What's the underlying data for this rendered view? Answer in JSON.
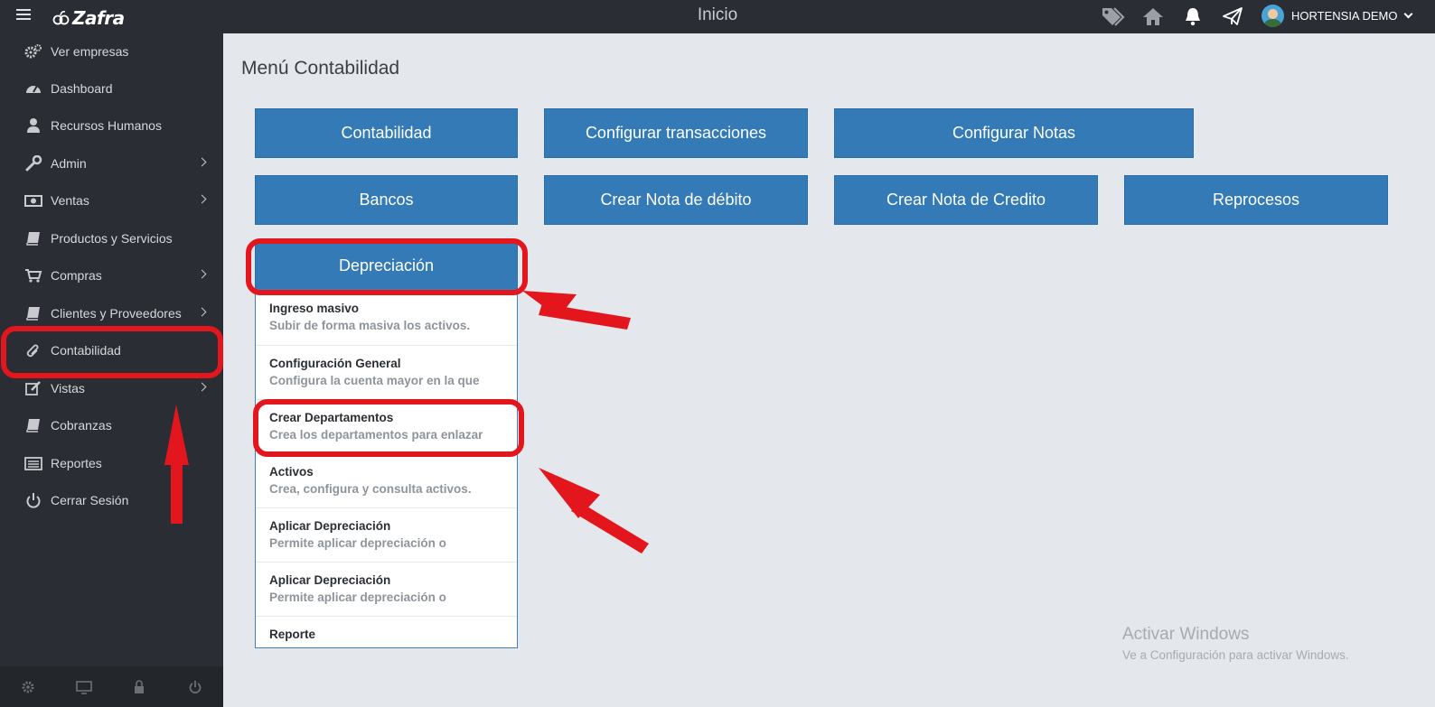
{
  "topbar": {
    "brand": "Zafra",
    "title": "Inicio",
    "icons": [
      "tags-icon",
      "home-icon",
      "bell-icon",
      "paper-plane-icon"
    ],
    "user_name": "HORTENSIA DEMO"
  },
  "sidebar": {
    "items": [
      {
        "label": "Ver empresas",
        "icon": "gears-icon",
        "arrow": false
      },
      {
        "label": "Dashboard",
        "icon": "dashboard-icon",
        "arrow": false
      },
      {
        "label": "Recursos Humanos",
        "icon": "user-icon",
        "arrow": false
      },
      {
        "label": "Admin",
        "icon": "wrench-icon",
        "arrow": true
      },
      {
        "label": "Ventas",
        "icon": "money-icon",
        "arrow": true
      },
      {
        "label": "Productos y Servicios",
        "icon": "book-icon",
        "arrow": false
      },
      {
        "label": "Compras",
        "icon": "cart-icon",
        "arrow": true
      },
      {
        "label": "Clientes y Proveedores",
        "icon": "book-icon",
        "arrow": true
      },
      {
        "label": "Contabilidad",
        "icon": "paperclip-icon",
        "arrow": false
      },
      {
        "label": "Vistas",
        "icon": "edit-icon",
        "arrow": true
      },
      {
        "label": "Cobranzas",
        "icon": "book-icon",
        "arrow": false
      },
      {
        "label": "Reportes",
        "icon": "list-icon",
        "arrow": false
      },
      {
        "label": "Cerrar Sesión",
        "icon": "power-icon",
        "arrow": false
      }
    ],
    "footer_icons": [
      "settings-icon",
      "monitor-icon",
      "lock-icon",
      "power-icon"
    ]
  },
  "main": {
    "title": "Menú Contabilidad",
    "buttons": {
      "contabilidad": "Contabilidad",
      "configurar_transacciones": "Configurar transacciones",
      "configurar_notas": "Configurar Notas",
      "bancos": "Bancos",
      "crear_nota_debito": "Crear Nota de débito",
      "crear_nota_credito": "Crear Nota de Credito",
      "reprocesos": "Reprocesos",
      "depreciacion": "Depreciación"
    },
    "dropdown": [
      {
        "title": "Ingreso masivo",
        "subtitle": "Subir de forma masiva los activos."
      },
      {
        "title": "Configuración General",
        "subtitle": "Configura la cuenta mayor en la que"
      },
      {
        "title": "Crear Departamentos",
        "subtitle": "Crea los departamentos para enlazar"
      },
      {
        "title": "Activos",
        "subtitle": "Crea, configura y consulta activos."
      },
      {
        "title": "Aplicar Depreciación",
        "subtitle": "Permite aplicar depreciación o"
      },
      {
        "title": "Aplicar Depreciación",
        "subtitle": "Permite aplicar depreciación o"
      },
      {
        "title": "Reporte",
        "subtitle": ""
      }
    ]
  },
  "watermark": {
    "line1": "Activar Windows",
    "line2": "Ve a Configuración para activar Windows."
  },
  "colors": {
    "topbar_bg": "#2a2d33",
    "button_blue": "#337ab7",
    "highlight_red": "#e3161e",
    "page_bg": "#e4e8ec"
  }
}
